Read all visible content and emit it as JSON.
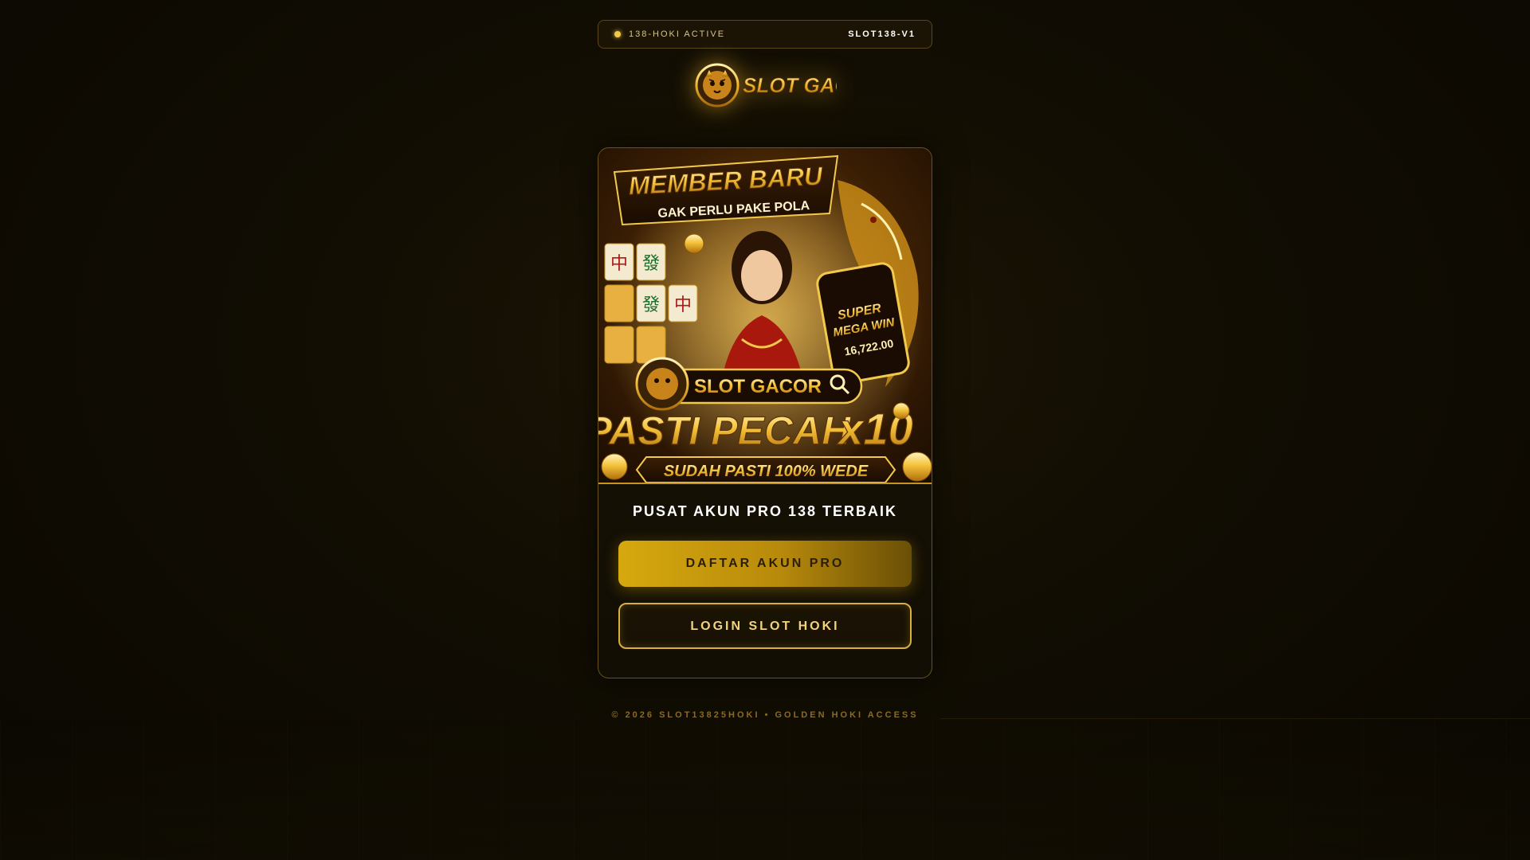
{
  "status_bar": {
    "status_text": "138-HOKI ACTIVE",
    "version": "SLOT138-V1"
  },
  "logo": {
    "text": "SLOT GACOR",
    "icon": "tiger-head-icon"
  },
  "banner": {
    "line1": "MEMBER BARU",
    "line2": "GAK PERLU PAKE POLA",
    "phone_text1": "SUPER",
    "phone_text2": "MEGA WIN",
    "phone_amount": "16,722.00",
    "search_label": "SLOT GACOR",
    "big_text": "PASTI PECAH",
    "multiplier": "x10",
    "bottom_text": "SUDAH PASTI 100% WEDE"
  },
  "card": {
    "headline": "PUSAT AKUN PRO 138 TERBAIK",
    "register_label": "DAFTAR AKUN PRO",
    "login_label": "LOGIN SLOT HOKI"
  },
  "footer": {
    "text": "© 2026 SLOT13825HOKI • GOLDEN HOKI ACCESS"
  },
  "colors": {
    "accent": "#d6a90f",
    "gold_text": "#f2d27a",
    "background": "#110d03"
  }
}
